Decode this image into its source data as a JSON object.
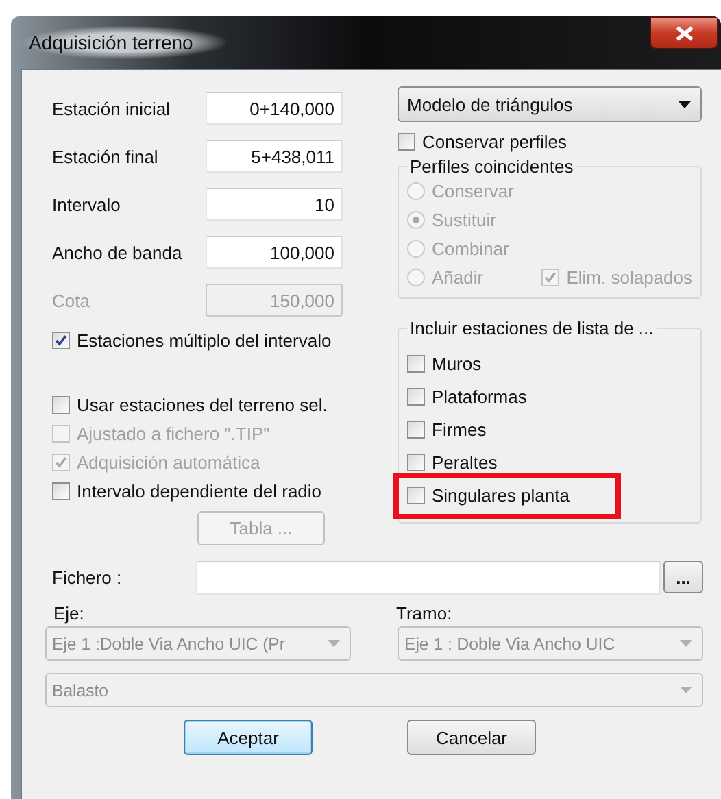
{
  "window": {
    "title": "Adquisición terreno"
  },
  "fields": [
    {
      "label": "Estación inicial",
      "value": "0+140,000",
      "disabled": false
    },
    {
      "label": "Estación final",
      "value": "5+438,011",
      "disabled": false
    },
    {
      "label": "Intervalo",
      "value": "10",
      "disabled": false
    },
    {
      "label": "Ancho de banda",
      "value": "100,000",
      "disabled": false
    },
    {
      "label": "Cota",
      "value": "150,000",
      "disabled": true
    }
  ],
  "multiple_stations": {
    "label": "Estaciones múltiplo del intervalo",
    "checked": true,
    "disabled": false
  },
  "terrain_options": [
    {
      "label": "Usar estaciones del terreno sel.",
      "checked": false,
      "disabled": false
    },
    {
      "label": "Ajustado a fichero \".TIP\"",
      "checked": false,
      "disabled": true
    },
    {
      "label": "Adquisición automática",
      "checked": true,
      "disabled": true
    },
    {
      "label": "Intervalo dependiente del radio",
      "checked": false,
      "disabled": false
    }
  ],
  "table_button": {
    "label": "Tabla ...",
    "disabled": true
  },
  "model_dropdown": {
    "value": "Modelo de triángulos"
  },
  "keep_profiles": {
    "label": "Conservar perfiles",
    "checked": false
  },
  "coincident_profiles": {
    "title": "Perfiles coincidentes",
    "disabled": true,
    "options": [
      {
        "label": "Conservar",
        "selected": false
      },
      {
        "label": "Sustituir",
        "selected": true
      },
      {
        "label": "Combinar",
        "selected": false
      },
      {
        "label": "Añadir",
        "selected": false
      }
    ],
    "remove_overlaps": {
      "label": "Elim. solapados",
      "checked": true
    }
  },
  "include_stations": {
    "title": "Incluir estaciones de lista de ...",
    "items": [
      {
        "label": "Muros",
        "checked": false,
        "highlighted": false
      },
      {
        "label": "Plataformas",
        "checked": false,
        "highlighted": false
      },
      {
        "label": "Firmes",
        "checked": false,
        "highlighted": false
      },
      {
        "label": "Peraltes",
        "checked": false,
        "highlighted": false
      },
      {
        "label": "Singulares planta",
        "checked": false,
        "highlighted": true
      }
    ]
  },
  "file": {
    "label": "Fichero :",
    "browse": "..."
  },
  "axis": {
    "label": "Eje:",
    "value": "Eje 1 :Doble Via Ancho UIC (Pr",
    "disabled": true
  },
  "section": {
    "label": "Tramo:",
    "value": "Eje 1 : Doble Via Ancho UIC",
    "disabled": true
  },
  "layer": {
    "value": "Balasto",
    "disabled": true
  },
  "buttons": [
    {
      "label": "Aceptar",
      "default": true
    },
    {
      "label": "Cancelar",
      "default": false
    }
  ]
}
